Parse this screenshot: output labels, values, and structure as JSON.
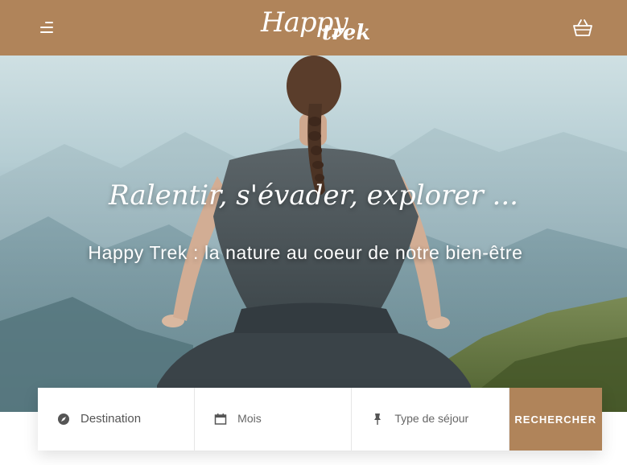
{
  "header": {
    "logo_happy": "Happy",
    "logo_trek": "trek",
    "menu_icon": "menu-icon",
    "cart_icon": "basket-icon"
  },
  "hero": {
    "title": "Ralentir, s'évader, explorer ...",
    "subtitle": "Happy Trek : la nature au coeur de notre bien-être"
  },
  "search": {
    "destination": {
      "label": "Destination",
      "icon": "compass-icon"
    },
    "month": {
      "label": "Mois",
      "icon": "calendar-icon"
    },
    "stay_type": {
      "label": "Type de séjour",
      "icon": "pin-icon"
    },
    "button_label": "RECHERCHER"
  },
  "colors": {
    "brand": "#b0845a",
    "white": "#ffffff"
  }
}
